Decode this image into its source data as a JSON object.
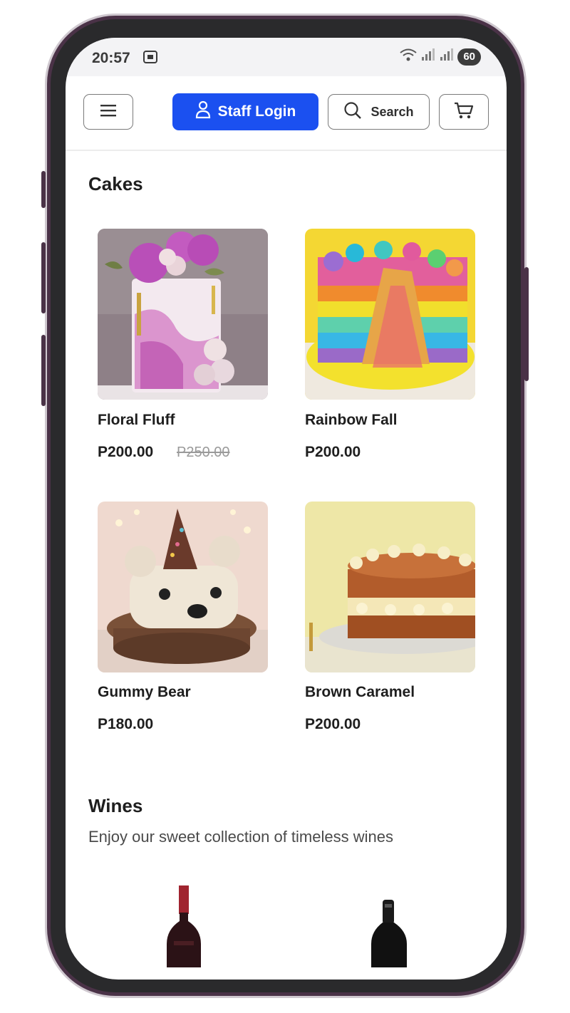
{
  "status_bar": {
    "time": "20:57",
    "battery": "60"
  },
  "header": {
    "staff_login_label": "Staff Login",
    "search_label": "Search"
  },
  "sections": [
    {
      "title": "Cakes",
      "products": [
        {
          "name": "Floral Fluff",
          "price": "P200.00",
          "old_price": "P250.00"
        },
        {
          "name": "Rainbow Fall",
          "price": "P200.00"
        },
        {
          "name": "Gummy Bear",
          "price": "P180.00"
        },
        {
          "name": "Brown Caramel",
          "price": "P200.00"
        }
      ]
    },
    {
      "title": "Wines",
      "subtitle": "Enjoy our sweet collection of timeless wines"
    }
  ],
  "colors": {
    "accent": "#1b50f0",
    "frame": "#4a3247"
  },
  "icons": [
    "screenshot-icon",
    "wifi-icon",
    "signal-icon",
    "menu-icon",
    "user-icon",
    "search-icon",
    "cart-icon"
  ]
}
